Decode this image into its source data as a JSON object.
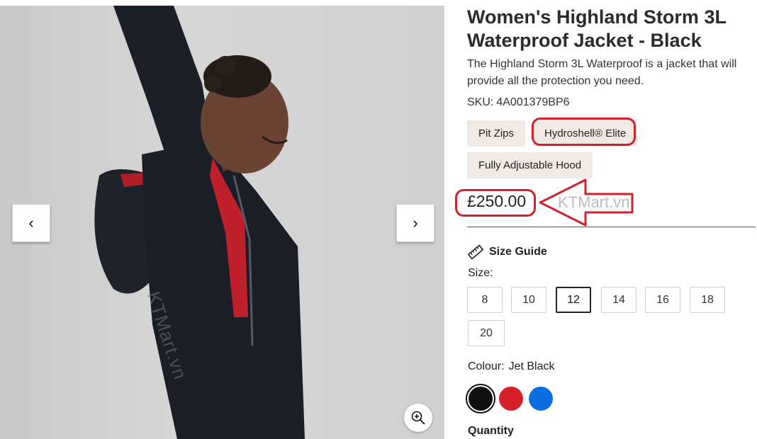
{
  "gallery": {
    "prev_glyph": "‹",
    "next_glyph": "›",
    "zoom_icon": "zoom-in-icon",
    "image_watermark": "KTMart.vn"
  },
  "product": {
    "title": "Women's Highland Storm 3L Waterproof Jacket - Black",
    "description": "The Highland Storm 3L Waterproof is a jacket that will provide all the protection you need.",
    "sku_label": "SKU:",
    "sku_value": "4A001379BP6",
    "features": [
      "Pit Zips",
      "Hydroshell® Elite",
      "Fully Adjustable Hood"
    ],
    "price": "£250.00",
    "price_watermark": "KTMart.vn"
  },
  "size": {
    "guide_label": "Size Guide",
    "label": "Size:",
    "options": [
      "8",
      "10",
      "12",
      "14",
      "16",
      "18",
      "20"
    ],
    "selected": "12"
  },
  "colour": {
    "label": "Colour:",
    "value": "Jet Black",
    "swatches": [
      {
        "name": "Jet Black",
        "hex": "#111111"
      },
      {
        "name": "Red",
        "hex": "#d62028"
      },
      {
        "name": "Blue",
        "hex": "#0a6ee0"
      }
    ]
  },
  "quantity": {
    "label": "Quantity"
  },
  "annotation_color": "#d0222b"
}
